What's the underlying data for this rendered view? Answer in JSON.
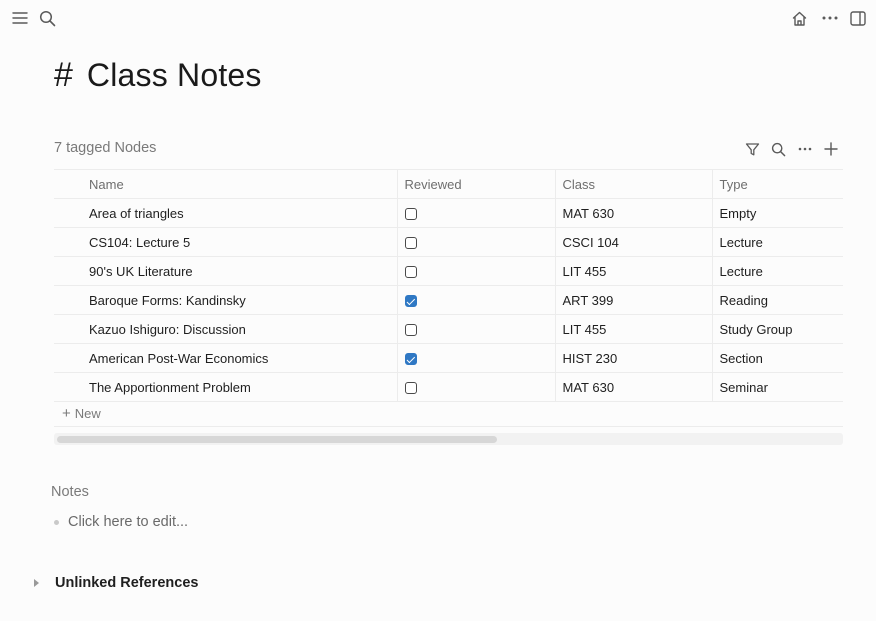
{
  "topbar": {
    "icons": [
      "menu-icon",
      "search-icon",
      "home-icon",
      "more-icon",
      "sidebar-toggle-icon"
    ]
  },
  "page": {
    "hash": "#",
    "title": "Class Notes"
  },
  "table": {
    "count_label": "7 tagged Nodes",
    "toolbar_icons": [
      "filter-icon",
      "search-icon",
      "more-icon",
      "plus-icon"
    ],
    "columns": [
      "Name",
      "Reviewed",
      "Class",
      "Type"
    ],
    "rows": [
      {
        "name": "Area of triangles",
        "reviewed": false,
        "class": "MAT 630",
        "type": "Empty"
      },
      {
        "name": "CS104: Lecture 5",
        "reviewed": false,
        "class": "CSCI 104",
        "type": "Lecture"
      },
      {
        "name": "90's UK Literature",
        "reviewed": false,
        "class": "LIT 455",
        "type": "Lecture"
      },
      {
        "name": "Baroque Forms: Kandinsky",
        "reviewed": true,
        "class": "ART 399",
        "type": "Reading"
      },
      {
        "name": "Kazuo Ishiguro: Discussion",
        "reviewed": false,
        "class": "LIT 455",
        "type": "Study Group"
      },
      {
        "name": "American Post-War Economics",
        "reviewed": true,
        "class": "HIST 230",
        "type": "Section"
      },
      {
        "name": "The Apportionment Problem",
        "reviewed": false,
        "class": "MAT 630",
        "type": "Seminar"
      }
    ],
    "new_plus": "+",
    "new_label": "New"
  },
  "notes": {
    "label": "Notes",
    "placeholder": "Click here to edit..."
  },
  "references": {
    "label": "Unlinked References"
  },
  "colors": {
    "checkbox_checked": "#2f78c4",
    "muted_text": "#7a7a7a"
  }
}
